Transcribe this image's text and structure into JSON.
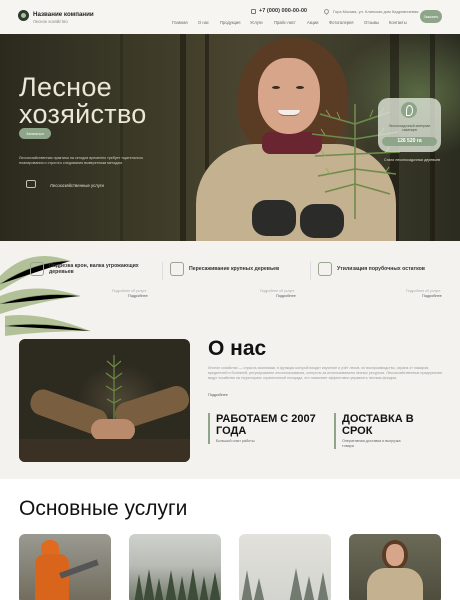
{
  "header": {
    "company_name": "Название компании",
    "company_sub": "Лесное хозяйство",
    "phone": "+7 (000) 000-00-00",
    "address": "Гора Москва, ул. Клинская дом Кадровичевая",
    "nav": [
      "Главная",
      "О нас",
      "Продукция",
      "Услуги",
      "Прайс-лист",
      "Акции",
      "Фотогалерея",
      "Отзывы",
      "Контакты"
    ],
    "cta_label": "Заказать"
  },
  "hero": {
    "title_line1": "Лесное",
    "title_line2": "хозяйство",
    "button_label": "Записаться",
    "description": "Лесохозяйственная практика на сегодня временно требует тщательного планирования и строгого следования выверенным методам.",
    "service_label": "Лесохозяйственные услуги",
    "stat_label": "Лесопосадочный материал саженцев",
    "stat_value": "126 520 га",
    "stat_caption": "Стали лесопосадочных деревьев"
  },
  "strip": {
    "items": [
      {
        "label": "Подрезка крон, валка угрожающих деревьев",
        "icon": "tree-cut-icon"
      },
      {
        "label": "Пересаживание крупных деревьев",
        "icon": "tree-transplant-icon"
      },
      {
        "label": "Утилизация порубочных остатков",
        "icon": "recycle-icon"
      }
    ],
    "mini": [
      {
        "label": "Подробнее об услуге",
        "more": "Подробнее"
      },
      {
        "label": "Подробнее об услуге",
        "more": "Подробнее"
      },
      {
        "label": "Подробнее об услуге",
        "more": "Подробнее"
      }
    ]
  },
  "about": {
    "title": "О нас",
    "text": "Лесное хозяйство — отрасль экономики, в функции которой входит изучение и учёт лесов, их воспроизводство, охрана от пожаров, вредителей и болезней, регулирование лесопользования, контроль за использованием лесных ресурсов. Лесохозяйственные предприятия ведут хозяйство на территориях ограниченной площади, что позволяет эффективно управлять лесным фондом.",
    "more": "Подробнее",
    "facts": [
      {
        "title_line1": "РАБОТАЕМ С 2007",
        "title_line2": "ГОДА",
        "sub": "Большой опыт работы"
      },
      {
        "title_line1": "ДОСТАВКА В",
        "title_line2": "СРОК",
        "sub": "Оперативная доставка и выгрузка товара"
      }
    ]
  },
  "services": {
    "title": "Основные услуги"
  },
  "colors": {
    "accent": "#8fa58a",
    "dark": "#2e3b2c",
    "background": "#f3f2ee"
  }
}
